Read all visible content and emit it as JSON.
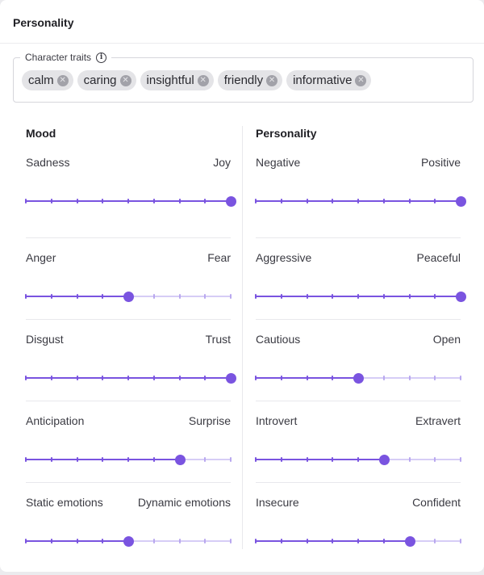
{
  "card": {
    "title": "Personality"
  },
  "traits": {
    "label": "Character traits",
    "info_icon": "info-icon",
    "chips": [
      "calm",
      "caring",
      "insightful",
      "friendly",
      "informative"
    ]
  },
  "colors": {
    "accent": "#7a54e0",
    "track": "#d6cdf6"
  },
  "mood": {
    "title": "Mood",
    "sliders": [
      {
        "left": "Sadness",
        "right": "Joy",
        "value": 1.0
      },
      {
        "left": "Anger",
        "right": "Fear",
        "value": 0.5
      },
      {
        "left": "Disgust",
        "right": "Trust",
        "value": 1.0
      },
      {
        "left": "Anticipation",
        "right": "Surprise",
        "value": 0.75
      },
      {
        "left": "Static emotions",
        "right": "Dynamic emotions",
        "value": 0.5
      }
    ]
  },
  "personality": {
    "title": "Personality",
    "sliders": [
      {
        "left": "Negative",
        "right": "Positive",
        "value": 1.0
      },
      {
        "left": "Aggressive",
        "right": "Peaceful",
        "value": 1.0
      },
      {
        "left": "Cautious",
        "right": "Open",
        "value": 0.5
      },
      {
        "left": "Introvert",
        "right": "Extravert",
        "value": 0.625
      },
      {
        "left": "Insecure",
        "right": "Confident",
        "value": 0.75
      }
    ]
  }
}
